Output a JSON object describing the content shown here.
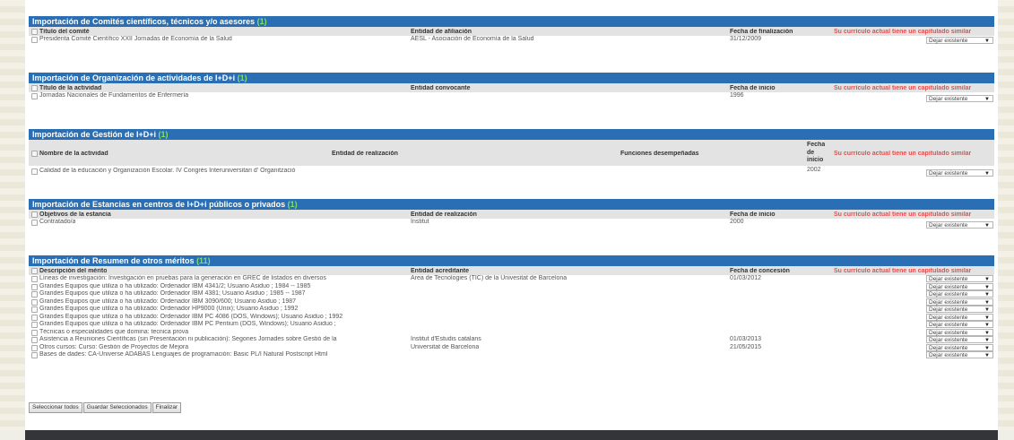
{
  "s1": {
    "title": "Importación de Comités científicos, técnicos y/o asesores",
    "count": "(1)",
    "headers": [
      "Título del comité",
      "Entidad de afiliación",
      "Fecha de finalización"
    ],
    "warning": "Su currículo actual tiene un capitulado similar",
    "rows": [
      {
        "c1": "Presidenta Comité Científico XXII Jornadas de Economía de la Salud",
        "c2": "AESL - Asociación de Economía de la Salud",
        "c3": "31/12/2009",
        "select": "Dejar existente"
      }
    ]
  },
  "s2": {
    "title": "Importación de Organización de actividades de I+D+i",
    "count": "(1)",
    "headers": [
      "Título de la actividad",
      "Entidad convocante",
      "Fecha de inicio"
    ],
    "warning": "Su currículo actual tiene un capitulado similar",
    "rows": [
      {
        "c1": "Jornadas Nacionales de Fundamentos de Enfermería",
        "c2": "",
        "c3": "1996",
        "select": "Dejar existente"
      }
    ]
  },
  "s3": {
    "title": "Importación de Gestión de I+D+i",
    "count": "(1)",
    "headers": [
      "Nombre de la actividad",
      "Entidad de realización",
      "Funciones desempeñadas",
      "Fecha de inicio"
    ],
    "header_fecha_lines": [
      "Fecha",
      "de",
      "inicio"
    ],
    "warning": "Su currículo actual tiene un capitulado similar",
    "rows": [
      {
        "c1": "Calidad de la educación y Organización Escolar. IV Congrés Interuniversitari d' Organització",
        "c2": "",
        "c3": "",
        "c4": "2002",
        "select": "Dejar existente"
      }
    ]
  },
  "s4": {
    "title": "Importación de Estancias en centros de I+D+i públicos o privados",
    "count": "(1)",
    "headers": [
      "Objetivos de la estancia",
      "Entidad de realización",
      "Fecha de inicio"
    ],
    "warning": "Su currículo actual tiene un capitulado similar",
    "rows": [
      {
        "c1": "Contratado/a",
        "c2": "Institut",
        "c3": "2000",
        "select": "Dejar existente"
      }
    ]
  },
  "s5": {
    "title": "Importación de Resumen de otros méritos",
    "count": "(11)",
    "headers": [
      "Descripción del mérito",
      "Entidad acreditante",
      "Fecha de concesión"
    ],
    "warning": "Su currículo actual tiene un capitulado similar",
    "rows": [
      {
        "c1": "Líneas de investigación: Investigación en pruebas para la generación en GREC de listados en diversos",
        "c2": "Àrea de Tecnologies (TIC) de la Univesitat de Barcelona",
        "c3": "01/03/2012",
        "select": "Dejar existente"
      },
      {
        "c1": "Grandes Equipos que utiliza o ha utilizado: Ordenador IBM 4341/2; Usuario Asiduo ; 1984 -- 1985",
        "c2": "",
        "c3": "",
        "select": "Dejar existente"
      },
      {
        "c1": "Grandes Equipos que utiliza o ha utilizado: Ordenador IBM 4381; Usuario Asiduo ; 1985 -- 1987",
        "c2": "",
        "c3": "",
        "select": "Dejar existente"
      },
      {
        "c1": "Grandes Equipos que utiliza o ha utilizado: Ordenador IBM 3090/600; Usuario Asiduo ; 1987",
        "c2": "",
        "c3": "",
        "select": "Dejar existente"
      },
      {
        "c1": "Grandes Equipos que utiliza o ha utilizado: Ordenador HP9000 (Unix); Usuario Asiduo ; 1992",
        "c2": "",
        "c3": "",
        "select": "Dejar existente"
      },
      {
        "c1": "Grandes Equipos que utiliza o ha utilizado: Ordenador IBM PC 4086 (DOS, Windows); Usuario Asiduo ; 1992",
        "c2": "",
        "c3": "",
        "select": "Dejar existente"
      },
      {
        "c1": "Grandes Equipos que utiliza o ha utilizado: Ordenador IBM PC Pentium (DOS, Windows); Usuario Asiduo ;",
        "c2": "",
        "c3": "",
        "select": "Dejar existente"
      },
      {
        "c1": "Técnicas o especialidades que domina: tecnica prova",
        "c2": "",
        "c3": "",
        "select": "Dejar existente"
      },
      {
        "c1": "Asistencia a Reuniones Científicas (sin Presentación ni publicación): Segones Jornades sobre Gestió de la",
        "c2": "Institut d'Estudis catalans",
        "c3": "01/03/2013",
        "select": "Dejar existente"
      },
      {
        "c1": "Otros cursos: Curso: Gestión de Proyectos de Mejora",
        "c2": "Universitat de Barcelona",
        "c3": "21/05/2015",
        "select": "Dejar existente"
      },
      {
        "c1": "Bases de dades: CA-Universe ADABAS Lenguajes de programación: Basic PL/I Natural Postscript Html",
        "c2": "",
        "c3": "",
        "select": "Dejar existente"
      }
    ]
  },
  "buttons": {
    "select_all": "Seleccionar todos",
    "save_selected": "Guardar Seleccionados",
    "finish": "Finalizar"
  }
}
